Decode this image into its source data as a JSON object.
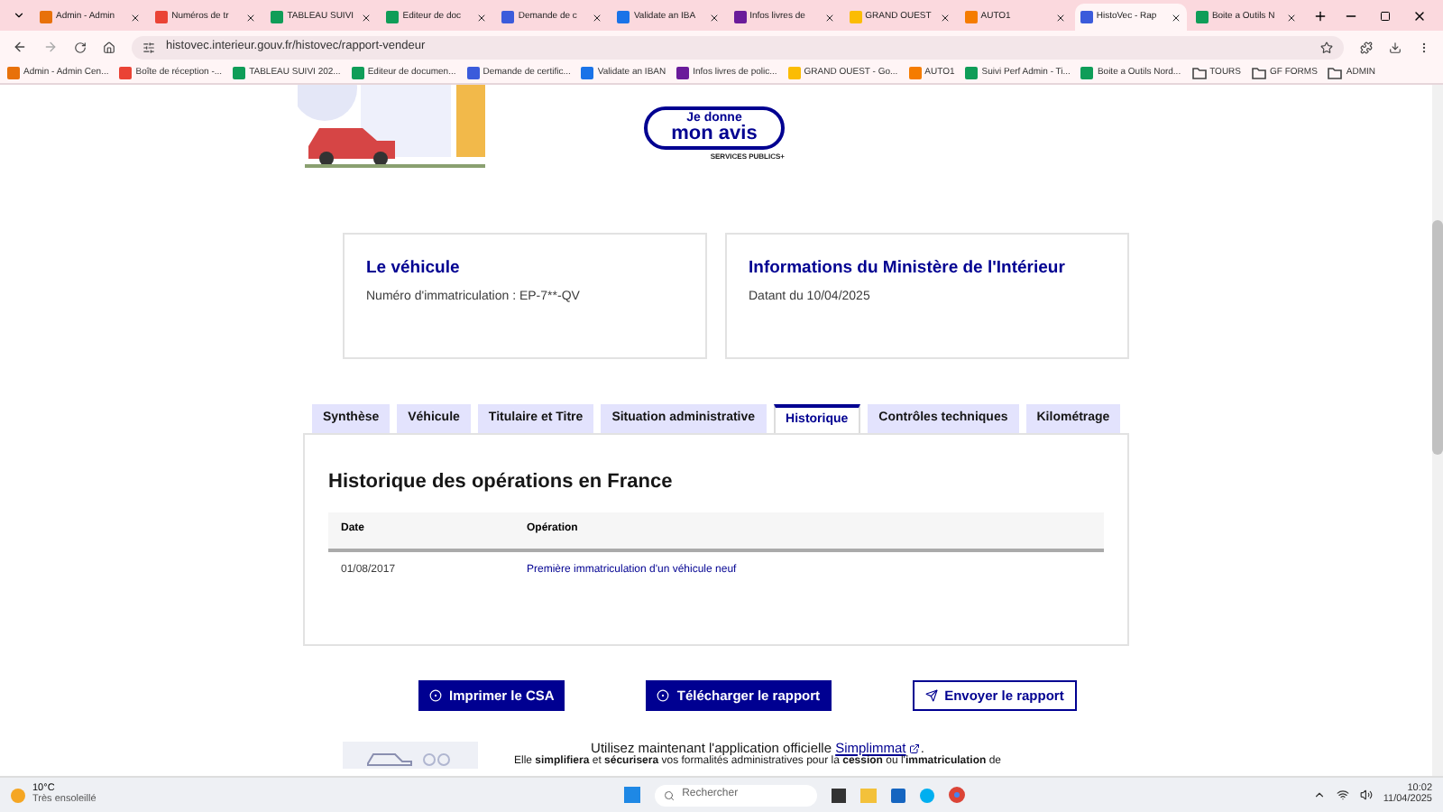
{
  "browser": {
    "tabs": [
      {
        "label": "Admin - Admin",
        "kind": "admin",
        "selected": false
      },
      {
        "label": "Numéros de tr",
        "kind": "mail",
        "selected": false
      },
      {
        "label": "TABLEAU SUIVI",
        "kind": "sheet",
        "selected": false
      },
      {
        "label": "Editeur de doc",
        "kind": "sheet",
        "selected": false
      },
      {
        "label": "Demande de c",
        "kind": "flag",
        "selected": false
      },
      {
        "label": "Validate an IBA",
        "kind": "iban",
        "selected": false
      },
      {
        "label": "Infos livres de",
        "kind": "book",
        "selected": false
      },
      {
        "label": "GRAND OUEST",
        "kind": "drive",
        "selected": false
      },
      {
        "label": "AUTO1",
        "kind": "auto",
        "selected": false
      },
      {
        "label": "HistoVec - Rap",
        "kind": "flag",
        "selected": true
      },
      {
        "label": "Boite a Outils N",
        "kind": "sheet",
        "selected": false
      }
    ],
    "url": "histovec.interieur.gouv.fr/histovec/rapport-vendeur",
    "bookmarks": [
      {
        "label": "Admin - Admin Cen...",
        "kind": "admin"
      },
      {
        "label": "Boîte de réception -...",
        "kind": "mail"
      },
      {
        "label": "TABLEAU SUIVI 202...",
        "kind": "sheet"
      },
      {
        "label": "Editeur de documen...",
        "kind": "sheet"
      },
      {
        "label": "Demande de certific...",
        "kind": "flag"
      },
      {
        "label": "Validate an IBAN",
        "kind": "iban"
      },
      {
        "label": "Infos livres de polic...",
        "kind": "book"
      },
      {
        "label": "GRAND OUEST - Go...",
        "kind": "drive"
      },
      {
        "label": "AUTO1",
        "kind": "auto"
      },
      {
        "label": "Suivi Perf Admin - Ti...",
        "kind": "sheet"
      },
      {
        "label": "Boite a Outils Nord...",
        "kind": "sheet"
      },
      {
        "label": "TOURS",
        "kind": "folder"
      },
      {
        "label": "GF FORMS",
        "kind": "folder"
      },
      {
        "label": "ADMIN",
        "kind": "folder"
      }
    ]
  },
  "feedback": {
    "line1": "Je donne",
    "line2": "mon avis",
    "brand": "SERVICES PUBLICS+"
  },
  "cards": [
    {
      "title": "Le véhicule",
      "text": "Numéro d'immatriculation : EP-7**-QV"
    },
    {
      "title": "Informations du Ministère de l'Intérieur",
      "text": "Datant du 10/04/2025"
    }
  ],
  "tabs": [
    {
      "label": "Synthèse",
      "selected": false
    },
    {
      "label": "Véhicule",
      "selected": false
    },
    {
      "label": "Titulaire et Titre",
      "selected": false
    },
    {
      "label": "Situation administrative",
      "selected": false
    },
    {
      "label": "Historique",
      "selected": true
    },
    {
      "label": "Contrôles techniques",
      "selected": false
    },
    {
      "label": "Kilométrage",
      "selected": false
    }
  ],
  "panel": {
    "title": "Historique des opérations en France",
    "columns": [
      "Date",
      "Opération"
    ],
    "rows": [
      {
        "date": "01/08/2017",
        "operation": "Première immatriculation d'un véhicule neuf"
      }
    ]
  },
  "actions": [
    {
      "label": "Imprimer le CSA",
      "kind": "primary"
    },
    {
      "label": "Télécharger le rapport",
      "kind": "primary"
    },
    {
      "label": "Envoyer le rapport",
      "kind": "secondary"
    }
  ],
  "promo": {
    "text": "Utilisez maintenant l'application officielle",
    "link": "Simplimmat",
    "tail": ".",
    "text2": "Elle **simplifiera** et **sécurisera** vos formalités administratives pour la **cession** ou l'**immatriculation** de"
  },
  "taskbar": {
    "temperature": "10°C",
    "weather": "Très ensoleillé",
    "search_placeholder": "Rechercher",
    "time": "10:02",
    "date": "11/04/2025"
  }
}
